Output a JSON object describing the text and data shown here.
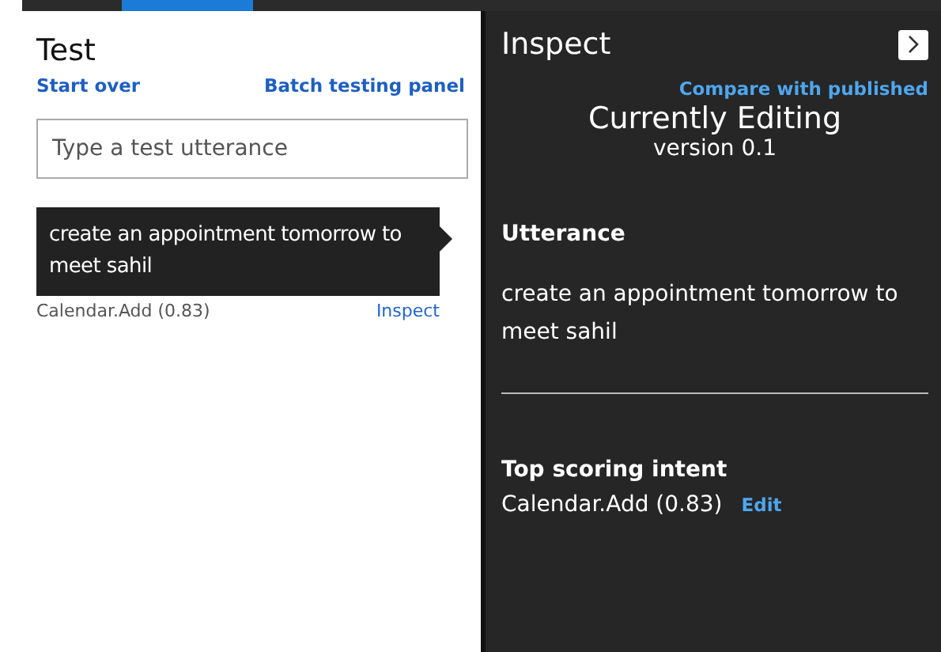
{
  "test_panel": {
    "title": "Test",
    "start_over": "Start over",
    "batch_testing": "Batch testing panel",
    "input": {
      "placeholder": "Type a test utterance"
    },
    "results": [
      {
        "utterance": "create an appointment tomorrow to meet sahil",
        "intent": "Calendar.Add (0.83)",
        "action": "Inspect",
        "selected": true
      }
    ]
  },
  "inspect_panel": {
    "title": "Inspect",
    "compare": "Compare with published",
    "heading": "Currently Editing",
    "version": "version 0.1",
    "utterance_label": "Utterance",
    "utterance": "create an appointment tomorrow to meet sahil",
    "intent_label": "Top scoring intent",
    "intent": "Calendar.Add (0.83)",
    "edit": "Edit"
  }
}
